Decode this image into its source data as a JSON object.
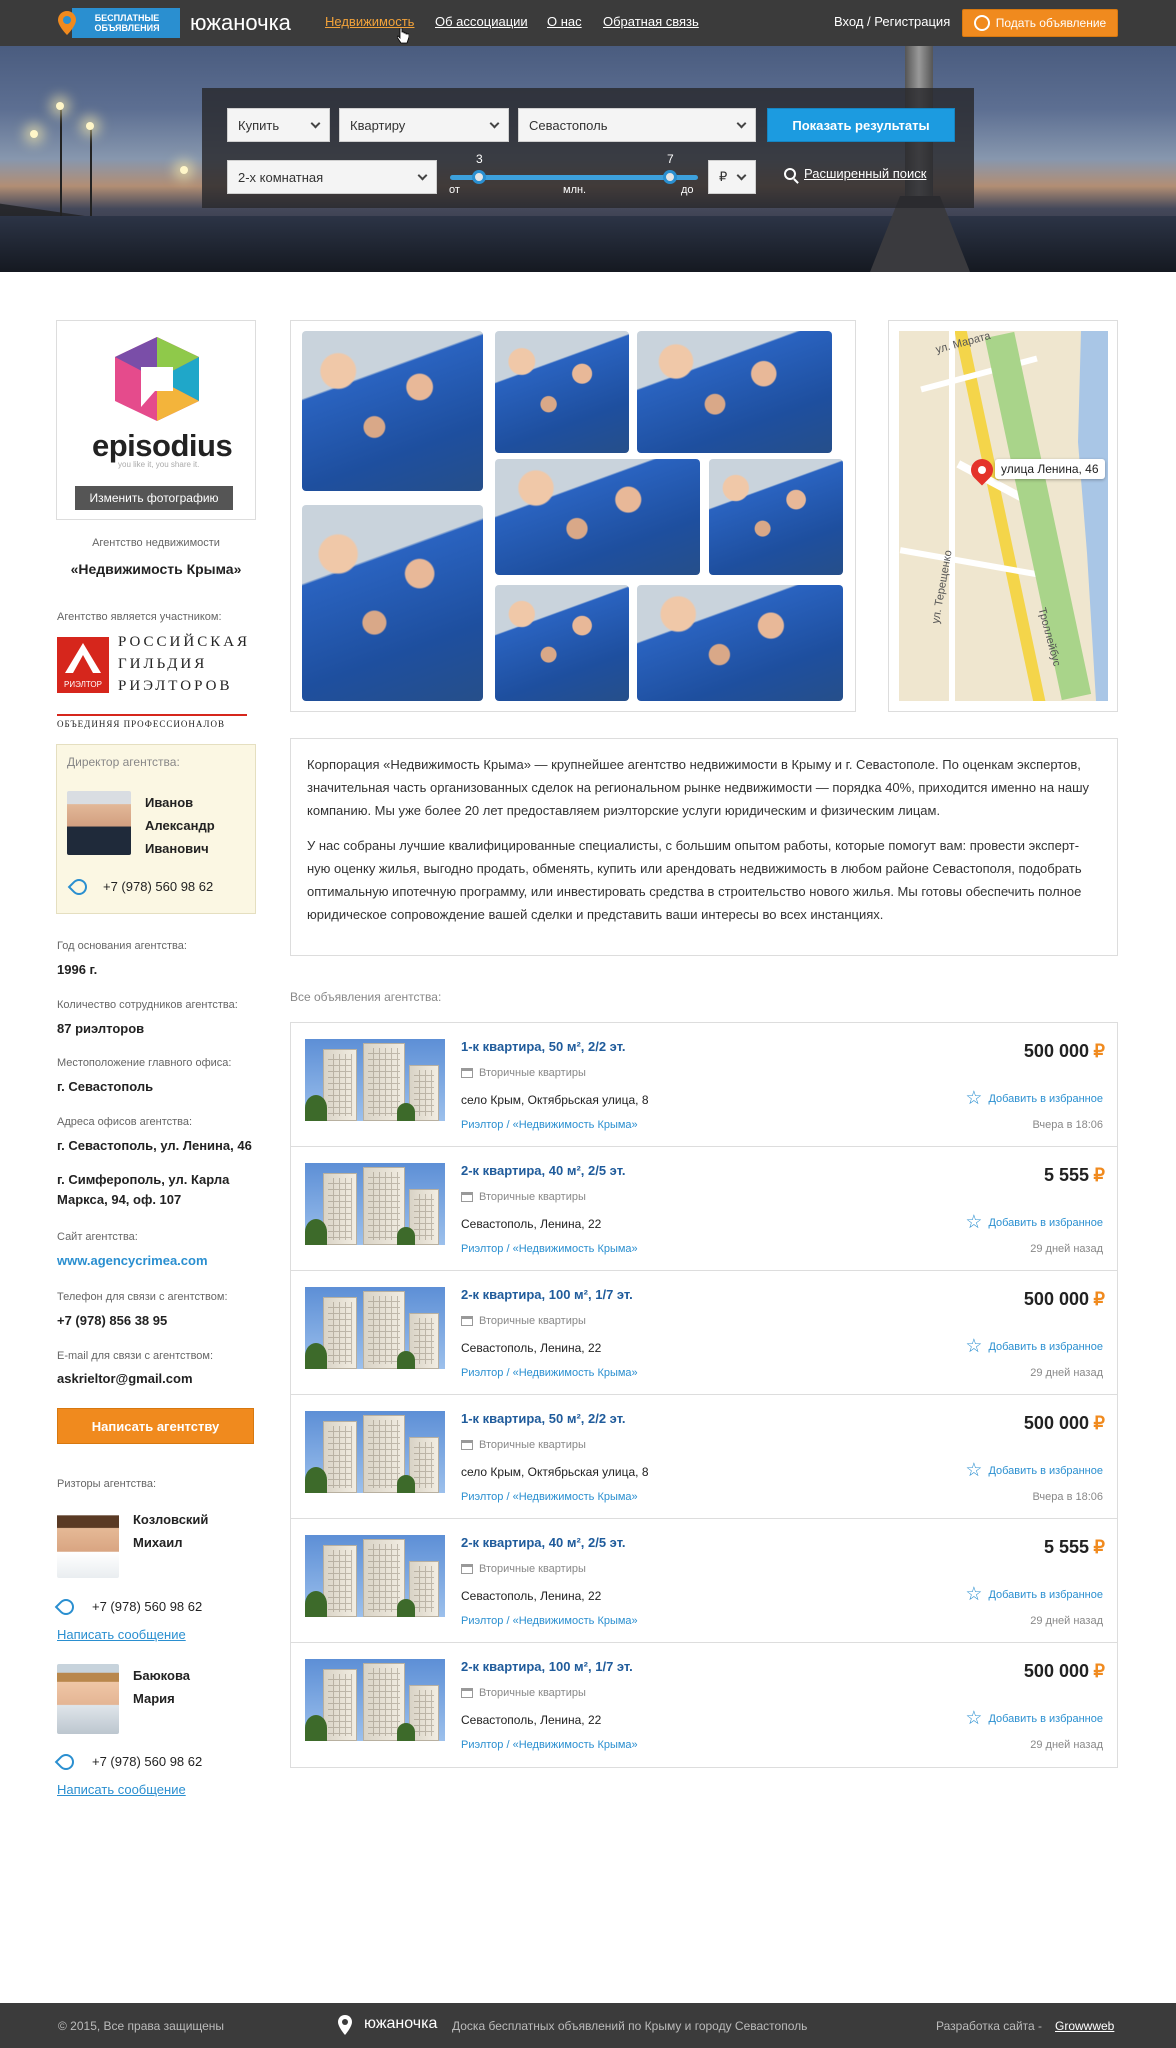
{
  "header": {
    "logo_badge": "БЕСПЛАТНЫЕ ОБЪЯВЛЕНИЯ",
    "logo_name": "южаночка",
    "nav": [
      "Недвижимость",
      "Об ассоциации",
      "О нас",
      "Обратная связь"
    ],
    "login": "Вход / Регистрация",
    "post_ad": "Подать объявление"
  },
  "search": {
    "deal": "Купить",
    "property": "Квартиру",
    "city": "Севастополь",
    "rooms": "2-х комнатная",
    "price_from": "3",
    "price_to": "7",
    "label_from": "от",
    "label_unit": "млн.",
    "label_to": "до",
    "currency": "₽",
    "show_button": "Показать результаты",
    "advanced": "Расширенный поиск"
  },
  "sidebar": {
    "logo_word": "episodius",
    "logo_tagline": "you like it, you share it.",
    "change_photo": "Изменить фотографию",
    "agency_type": "Агентство недвижимости",
    "agency_name": "«Недвижимость Крыма»",
    "member_label": "Агентство является участником:",
    "guild_line1": "РОССИЙСКАЯ",
    "guild_line2": "ГИЛЬДИЯ",
    "guild_line3": "РИЭЛТОРОВ",
    "guild_mark": "РИЭЛТОР",
    "guild_sub": "ОБЪЕДИНЯЯ ПРОФЕССИОНАЛОВ",
    "director_label": "Директор агентства:",
    "director_name1": "Иванов",
    "director_name2": "Александр",
    "director_name3": "Иванович",
    "director_phone": "+7 (978) 560 98 62",
    "founded_label": "Год основания агентства:",
    "founded": "1996 г.",
    "staff_label": "Количество сотрудников агентства:",
    "staff": "87 риэлторов",
    "hq_label": "Местоположение главного офиса:",
    "hq": "г. Севастополь",
    "offices_label": "Адреса офисов агентства:",
    "office1": "г. Севастополь, ул. Ленина, 46",
    "office2a": "г. Симферополь, ул. Карла",
    "office2b": "Маркса, 94, оф. 107",
    "site_label": "Сайт агентства:",
    "site": "www.agencycrimea.com",
    "phone_label": "Телефон для связи с  агентством:",
    "phone": "+7 (978) 856 38 95",
    "email_label": "E-mail для связи с  агентством:",
    "email": "askrieltor@gmail.com",
    "write_button": "Написать агентству",
    "realtors_label": "Ризторы агентства:",
    "realtors": [
      {
        "name1": "Козловский",
        "name2": "Михаил",
        "phone": "+7 (978) 560 98 62",
        "message": "Написать сообщение"
      },
      {
        "name1": "Баюкова",
        "name2": "Мария",
        "phone": "+7 (978) 560 98 62",
        "message": "Написать сообщение"
      }
    ]
  },
  "map": {
    "label": "улица Ленина, 46",
    "street1": "ул. Марата",
    "street2": "ул. Терещенко",
    "street3": "Троллейбус"
  },
  "description": {
    "p1": "Корпорация «Недвижимость Крыма» — крупнейшее агентство недвижимости в Крыму и г. Севастополе. По оценкам экспертов, значительная часть организованных сделок на региональном рынке недвижимости — порядка 40%, приходится именно на нашу компанию. Мы уже более 20 лет предоставляем риэлторские услуги юридическим и физическим лицам.",
    "p2": "У нас собраны лучшие квалифицированные специалисты, с большим опытом работы, которые помогут вам: провести эксперт-ную оценку жилья, выгодно продать, обменять, купить или арендовать недвижимость в любом районе Севастополя, подобрать оптимальную ипотечную программу, или инвестировать средства в строительство нового жилья. Мы готовы обеспечить полное юридическое сопровождение вашей сделки и представить ваши интересы во всех инстанциях."
  },
  "listings_label": "Все объявления агентства:",
  "listings": [
    {
      "title": "1-к квартира, 50 м², 2/2 эт.",
      "type": "Вторичные квартиры",
      "address": "село Крым, Октябрьская улица, 8",
      "agent": "Риэлтор / «Недвижимость Крыма»",
      "price": "500 000",
      "fav": "Добавить в избранное",
      "date": "Вчера в 18:06"
    },
    {
      "title": "2-к квартира, 40 м², 2/5 эт.",
      "type": "Вторичные квартиры",
      "address": "Севастополь, Ленина, 22",
      "agent": "Риэлтор / «Недвижимость Крыма»",
      "price": "5 555",
      "fav": "Добавить в избранное",
      "date": "29 дней назад"
    },
    {
      "title": "2-к квартира, 100 м², 1/7 эт.",
      "type": "Вторичные квартиры",
      "address": "Севастополь, Ленина, 22",
      "agent": "Риэлтор / «Недвижимость Крыма»",
      "price": "500 000",
      "fav": "Добавить в избранное",
      "date": "29 дней назад"
    },
    {
      "title": "1-к квартира, 50 м², 2/2 эт.",
      "type": "Вторичные квартиры",
      "address": "село Крым, Октябрьская улица, 8",
      "agent": "Риэлтор / «Недвижимость Крыма»",
      "price": "500 000",
      "fav": "Добавить в избранное",
      "date": "Вчера в 18:06"
    },
    {
      "title": "2-к квартира, 40 м², 2/5 эт.",
      "type": "Вторичные квартиры",
      "address": "Севастополь, Ленина, 22",
      "agent": "Риэлтор / «Недвижимость Крыма»",
      "price": "5 555",
      "fav": "Добавить в избранное",
      "date": "29 дней назад"
    },
    {
      "title": "2-к квартира, 100 м², 1/7 эт.",
      "type": "Вторичные квартиры",
      "address": "Севастополь, Ленина, 22",
      "agent": "Риэлтор / «Недвижимость Крыма»",
      "price": "500 000",
      "fav": "Добавить в избранное",
      "date": "29 дней назад"
    }
  ],
  "currency_symbol": "₽",
  "footer": {
    "copyright": "© 2015, Все права защищены",
    "brand": "южаночка",
    "tagline": "Доска бесплатных объявлений по Крыму и городу Севастополь",
    "dev_label": "Разработка сайта -",
    "dev_link": "Growwweb"
  },
  "colors": {
    "accent_orange": "#f08a1e",
    "accent_blue": "#2a8fd0",
    "dark_bar": "#3b3b3b"
  }
}
